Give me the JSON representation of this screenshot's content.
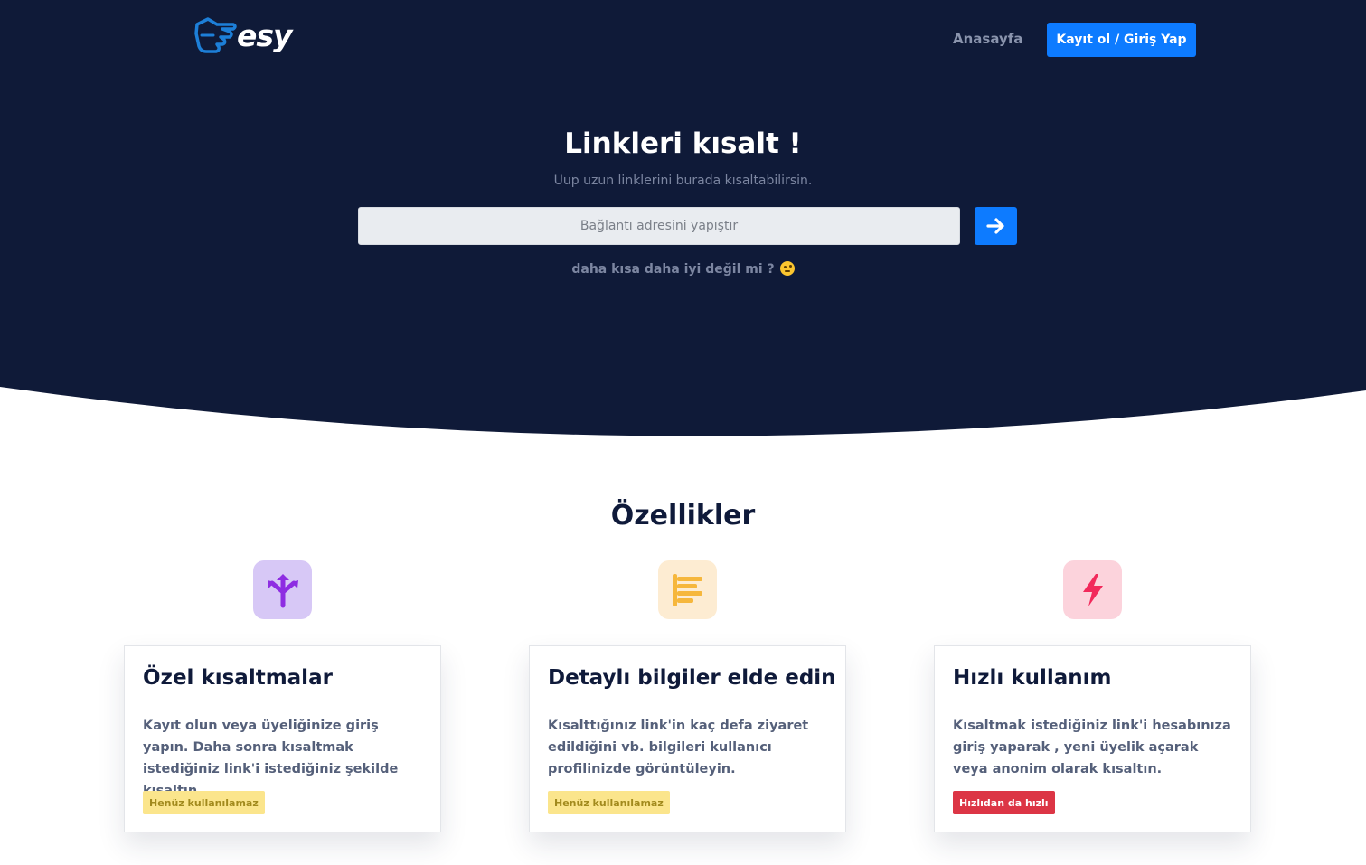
{
  "brand": {
    "logo_text": "esy"
  },
  "nav": {
    "home": "Anasayfa",
    "login": "Kayıt ol / Giriş Yap"
  },
  "hero": {
    "title": "Linkleri kısalt !",
    "subtitle": "Uup uzun linklerini burada kısaltabilirsin.",
    "input_placeholder": "Bağlantı adresini yapıştır",
    "input_value": "",
    "submit_icon": "arrow-right-icon",
    "tagline": "daha kısa daha iyi değil mi ?",
    "tagline_emoji": "wink-emoji"
  },
  "colors": {
    "hero_bg": "#0f1a38",
    "accent": "#0d7bff",
    "warn_badge": "#fbe58c",
    "danger_badge": "#dc3545"
  },
  "features": {
    "title": "Özellikler",
    "items": [
      {
        "icon": "split-arrows-icon",
        "icon_color": "#8e2de2",
        "title": "Özel kısaltmalar",
        "text": "Kayıt olun veya üyeliğinize giriş yapın. Daha sonra kısaltmak istediğiniz link'i istediğiniz şekilde kısaltın.",
        "badge": "Henüz kullanılamaz"
      },
      {
        "icon": "align-left-bars-icon",
        "icon_color": "#f6b73c",
        "title": "Detaylı bilgiler elde edin",
        "text": "Kısalttığınız link'in kaç defa ziyaret edildiğini vb. bilgileri kullanıcı profilinizde görüntüleyin.",
        "badge": "Henüz kullanılamaz"
      },
      {
        "icon": "lightning-bolt-icon",
        "icon_color": "#f2295b",
        "title": "Hızlı kullanım",
        "text": "Kısaltmak istediğiniz link'i hesabınıza giriş yaparak , yeni üyelik açarak veya anonim olarak kısaltın.",
        "badge": "Hızlıdan da hızlı"
      }
    ]
  }
}
